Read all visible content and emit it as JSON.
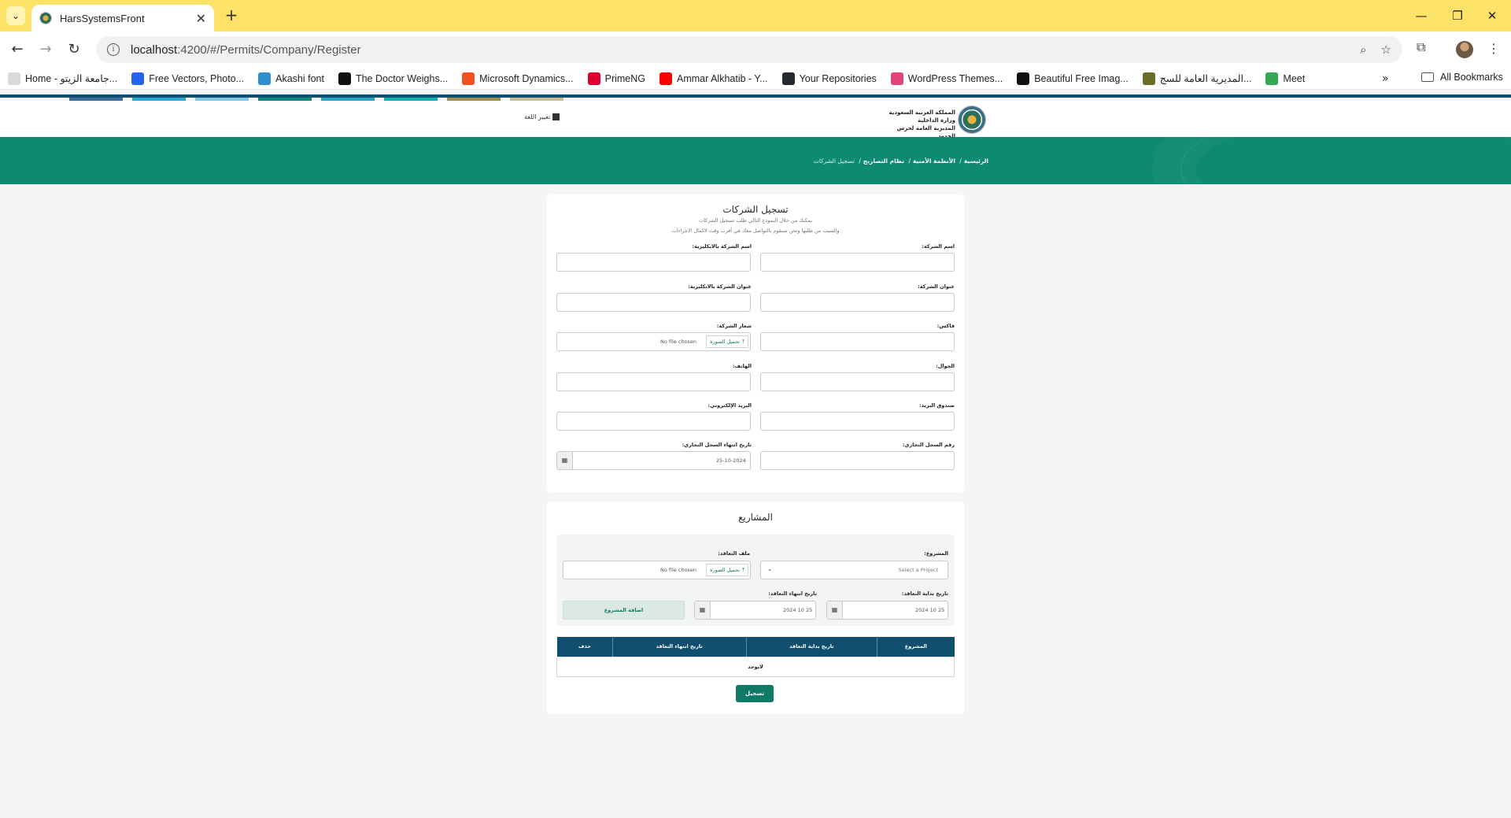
{
  "browser": {
    "tab_title": "HarsSystemsFront",
    "url_host": "localhost",
    "url_path": ":4200/#/Permits/Company/Register",
    "bookmarks": [
      {
        "label": "Home - جامعة الزيتو...",
        "color": "#d9d9d9"
      },
      {
        "label": "Free Vectors, Photo...",
        "color": "#2463eb"
      },
      {
        "label": "Akashi font",
        "color": "#2f8fd0"
      },
      {
        "label": "The Doctor Weighs...",
        "color": "#111111"
      },
      {
        "label": "Microsoft Dynamics...",
        "color": "#f25022"
      },
      {
        "label": "PrimeNG",
        "color": "#dd0031"
      },
      {
        "label": "Ammar Alkhatib - Y...",
        "color": "#ff0000"
      },
      {
        "label": "Your Repositories",
        "color": "#24292f"
      },
      {
        "label": "WordPress Themes...",
        "color": "#e0447a"
      },
      {
        "label": "Beautiful Free Imag...",
        "color": "#111111"
      },
      {
        "label": "المديرية العامة للسج...",
        "color": "#6b6b2a"
      },
      {
        "label": "Meet",
        "color": "#34a853"
      }
    ],
    "all_bookmarks": "All Bookmarks"
  },
  "site": {
    "lang_switch": "تغيير اللغة",
    "org_line1": "المملكة العربية السعودية",
    "org_line2": "وزارة الداخلية",
    "org_line3": "المديرية العامة لحرس الحدود",
    "breadcrumb": [
      "الرئيسية",
      "الأنظمة الأمنية",
      "نظام التصاريح"
    ],
    "breadcrumb_current": "تسجيل الشركات"
  },
  "form": {
    "title": "تسجيل الشركات",
    "subtitle_line1": "يمكنك من خلال النموذج التالي طلب تسجيل الشركات",
    "subtitle_line2": "والسبب من طلبها ونحن سنقوم بالتواصل معك في أقرب وقت لاكمال الاجراءات",
    "company_name": "اسم الشركة:",
    "company_name_en": "اسم الشركة بالانكليزية:",
    "company_address": "عنوان الشركة:",
    "company_address_en": "عنوان الشركة بالانكليزية:",
    "fax": "فاكس:",
    "logo": "شعار الشركة:",
    "mobile": "الجوال:",
    "phone": "الهاتف:",
    "po_box": "صندوق البريد:",
    "email": "البريد الإلكتروني:",
    "cr_number": "رقم السجل التجاري:",
    "cr_expiry": "تاريخ انتهاء السجل التجاري:",
    "cr_expiry_value": "25-10-2024",
    "upload_label": "تحميل الصورة",
    "no_file": "No file chosen"
  },
  "projects": {
    "title": "المشاريع",
    "project_label": "المشروع:",
    "project_placeholder": "Select a Project",
    "contract_file_label": "ملف التعاقد:",
    "contract_start_label": "تاريخ بداية التعاقد:",
    "contract_end_label": "تاريخ انتهاء التعاقد:",
    "contract_start_value": "25 10 2024",
    "contract_end_value": "25 10 2024",
    "add_button": "اضافة المشروع",
    "table_headers": [
      "المشروع",
      "تاريخ بداية التعاقد",
      "تاريخ انتهاء التعاقد",
      "حذف"
    ],
    "empty_text": "لايوجد",
    "submit": "تسجيل"
  }
}
